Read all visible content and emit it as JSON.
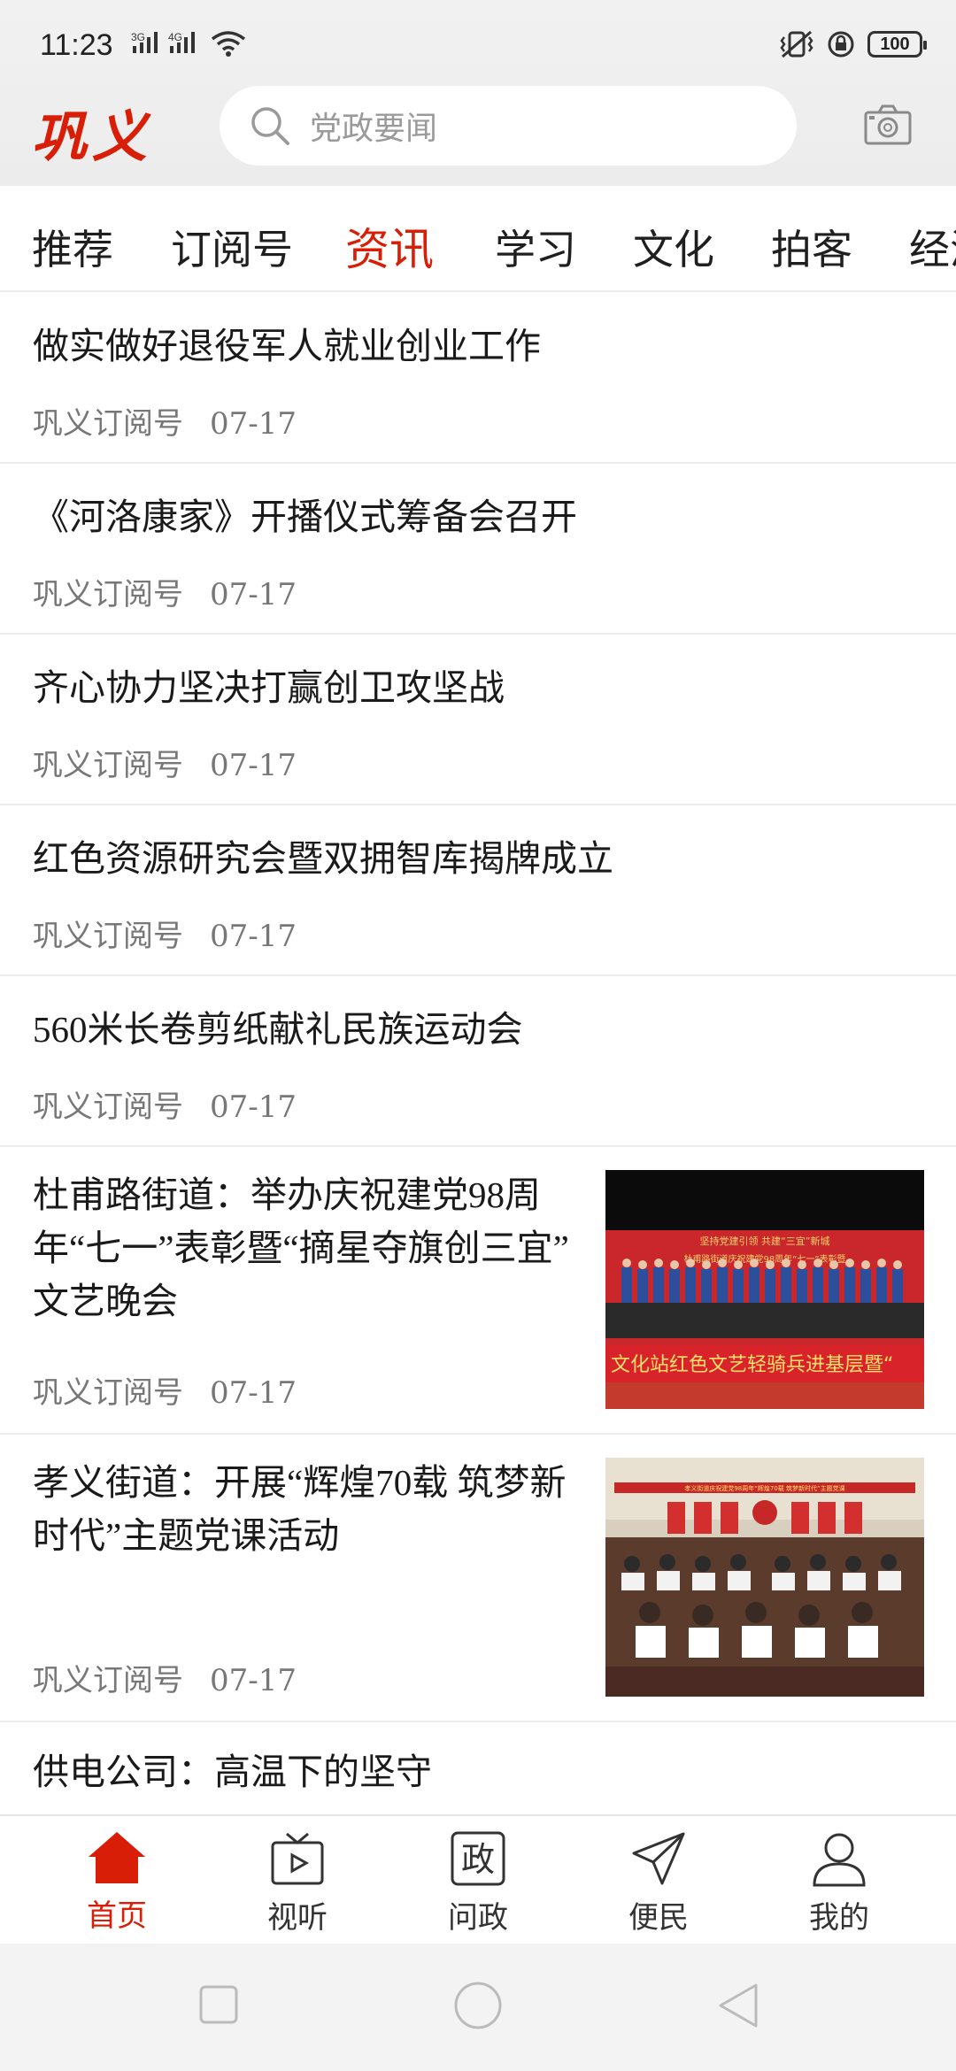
{
  "status": {
    "time": "11:23",
    "battery": "100",
    "sig1": "3G",
    "sig2": "4G"
  },
  "header": {
    "logo": "巩义",
    "search_placeholder": "党政要闻"
  },
  "tabs": [
    {
      "label": "推荐",
      "active": false
    },
    {
      "label": "订阅号",
      "active": false
    },
    {
      "label": "资讯",
      "active": true
    },
    {
      "label": "学习",
      "active": false
    },
    {
      "label": "文化",
      "active": false
    },
    {
      "label": "拍客",
      "active": false
    },
    {
      "label": "经济",
      "active": false
    }
  ],
  "articles": [
    {
      "title": "做实做好退役军人就业创业工作",
      "source": "巩义订阅号",
      "date": "07-17"
    },
    {
      "title": "《河洛康家》开播仪式筹备会召开",
      "source": "巩义订阅号",
      "date": "07-17"
    },
    {
      "title": "齐心协力坚决打赢创卫攻坚战",
      "source": "巩义订阅号",
      "date": "07-17"
    },
    {
      "title": "红色资源研究会暨双拥智库揭牌成立",
      "source": "巩义订阅号",
      "date": "07-17"
    },
    {
      "title": "560米长卷剪纸献礼民族运动会",
      "source": "巩义订阅号",
      "date": "07-17"
    },
    {
      "title": "杜甫路街道：举办庆祝建党98周年“七一”表彰暨“摘星夺旗创三宜” 文艺晚会",
      "source": "巩义订阅号",
      "date": "07-17",
      "thumb": {
        "banner_top": "坚持党建引领 共建“三宜”新城",
        "banner_mid": "杜甫路街道庆祝建党98周年“七一”表彰暨",
        "banner_bottom": "文化站红色文艺轻骑兵进基层暨“"
      }
    },
    {
      "title": "孝义街道：开展“辉煌70载 筑梦新时代”主题党课活动",
      "source": "巩义订阅号",
      "date": "07-17",
      "thumb": {
        "banner_top": "孝义街道庆祝建党98周年“辉煌70载 筑梦新时代”主题党课"
      }
    },
    {
      "title": "供电公司：高温下的坚守",
      "source": "",
      "date": ""
    }
  ],
  "bottom_nav": [
    {
      "label": "首页",
      "icon": "home-icon",
      "active": true
    },
    {
      "label": "视听",
      "icon": "tv-icon",
      "active": false
    },
    {
      "label": "问政",
      "icon": "zheng-icon",
      "glyph": "政",
      "active": false
    },
    {
      "label": "便民",
      "icon": "send-icon",
      "active": false
    },
    {
      "label": "我的",
      "icon": "user-icon",
      "active": false
    }
  ],
  "colors": {
    "accent": "#d81e06",
    "text": "#1a1a1a",
    "meta": "#777777",
    "divider": "#ececec"
  }
}
